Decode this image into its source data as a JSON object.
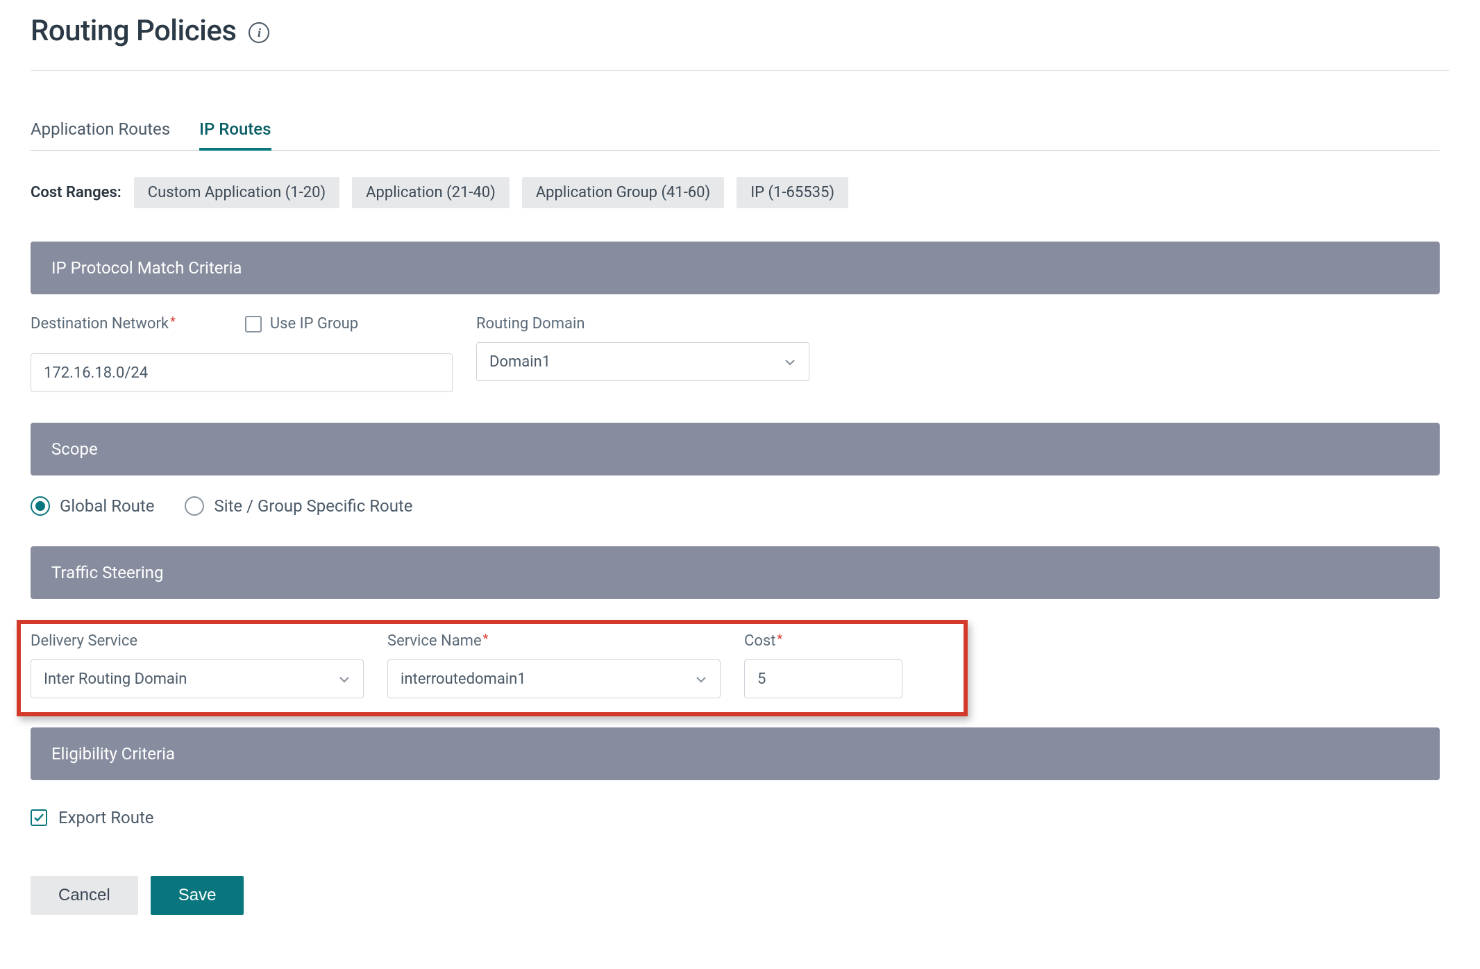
{
  "page_title": "Routing Policies",
  "tabs": {
    "application_routes": "Application Routes",
    "ip_routes": "IP Routes",
    "active": "ip_routes"
  },
  "cost_ranges": {
    "label": "Cost Ranges:",
    "chips": [
      "Custom Application (1-20)",
      "Application (21-40)",
      "Application Group (41-60)",
      "IP (1-65535)"
    ]
  },
  "sections": {
    "ip_match": "IP Protocol Match Criteria",
    "scope": "Scope",
    "traffic_steering": "Traffic Steering",
    "eligibility": "Eligibility Criteria"
  },
  "ip_match": {
    "destination_network_label": "Destination Network",
    "destination_network_value": "172.16.18.0/24",
    "use_ip_group_label": "Use IP Group",
    "use_ip_group_checked": false,
    "routing_domain_label": "Routing Domain",
    "routing_domain_value": "Domain1"
  },
  "scope": {
    "global_route": "Global Route",
    "site_specific": "Site / Group Specific Route",
    "selected": "global_route"
  },
  "traffic_steering": {
    "delivery_service_label": "Delivery Service",
    "delivery_service_value": "Inter Routing Domain",
    "service_name_label": "Service Name",
    "service_name_value": "interroutedomain1",
    "cost_label": "Cost",
    "cost_value": "5"
  },
  "export_route": {
    "label": "Export Route",
    "checked": true
  },
  "buttons": {
    "cancel": "Cancel",
    "save": "Save"
  }
}
